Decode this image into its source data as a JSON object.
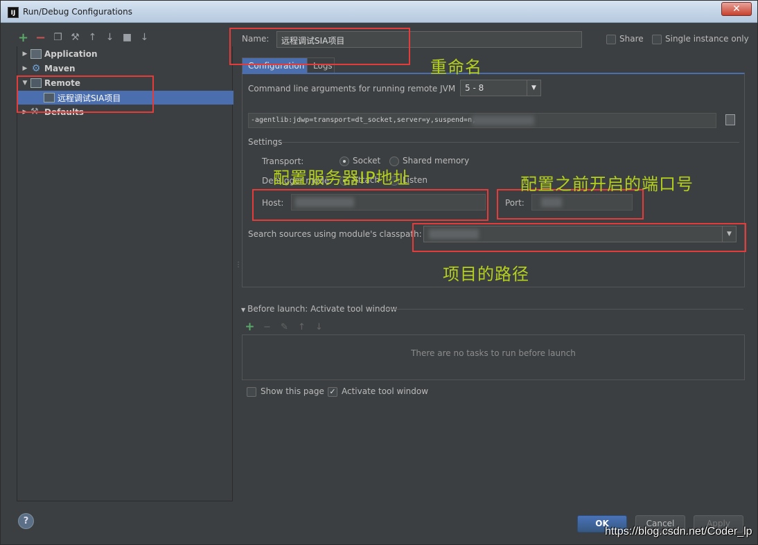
{
  "window": {
    "title": "Run/Debug Configurations",
    "icon_label": "IJ"
  },
  "left_toolbar": {
    "icons": [
      "add-icon",
      "remove-icon",
      "copy-icon",
      "wrench-icon",
      "move-up-icon",
      "move-down-icon",
      "folder-icon",
      "sort-icon"
    ]
  },
  "tree": {
    "items": [
      {
        "label": "Application",
        "icon": "application-icon",
        "expanded": false
      },
      {
        "label": "Maven",
        "icon": "maven-icon",
        "expanded": false
      },
      {
        "label": "Remote",
        "icon": "remote-icon",
        "expanded": true
      },
      {
        "label": "远程调试SIA项目",
        "icon": "remote-config-icon",
        "selected": true
      },
      {
        "label": "Defaults",
        "icon": "defaults-icon",
        "expanded": false
      }
    ]
  },
  "config": {
    "name_label": "Name:",
    "name_value": "远程调试SIA项目",
    "share_label": "Share",
    "single_instance_label": "Single instance only"
  },
  "tabs": [
    "Configuration",
    "Logs"
  ],
  "configuration": {
    "cmd_label": "Command line arguments for running remote JVM",
    "jvm_version": "5 - 8",
    "args": "-agentlib:jdwp=transport=dt_socket,server=y,suspend=n,",
    "settings_label": "Settings",
    "transport_label": "Transport:",
    "transport_options": [
      "Socket",
      "Shared memory"
    ],
    "transport_selected": "Socket",
    "debugger_mode_label": "Debugger mode:",
    "debugger_mode_options": [
      "Attach",
      "Listen"
    ],
    "debugger_mode_selected": "Attach",
    "host_label": "Host:",
    "port_label": "Port:",
    "search_sources_label": "Search sources using module's classpath:"
  },
  "before_launch": {
    "label": "Before launch: Activate tool window",
    "empty_text": "There are no tasks to run before launch"
  },
  "options": {
    "show_page_label": "Show this page",
    "show_page_checked": false,
    "activate_label": "Activate tool window",
    "activate_checked": true
  },
  "buttons": {
    "ok": "OK",
    "cancel": "Cancel",
    "apply": "Apply",
    "help": "?"
  },
  "annotations": {
    "rename": "重命名",
    "host_note": "配置服务器IP地址",
    "port_note": "配置之前开启的端口号",
    "path_note": "项目的路径",
    "annotation_color": "#e43b3b",
    "note_color": "#b5d11d"
  },
  "watermark": "https://blog.csdn.net/Coder_lp"
}
